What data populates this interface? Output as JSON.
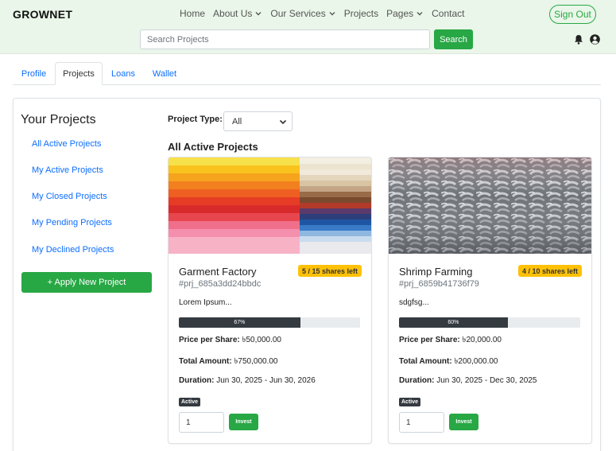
{
  "header": {
    "brand": "GROWNET",
    "nav": [
      {
        "label": "Home",
        "dropdown": false
      },
      {
        "label": "About Us",
        "dropdown": true
      },
      {
        "label": "Our Services",
        "dropdown": true
      },
      {
        "label": "Projects",
        "dropdown": false
      },
      {
        "label": "Pages",
        "dropdown": true
      },
      {
        "label": "Contact",
        "dropdown": false
      }
    ],
    "signout_label": "Sign Out",
    "search_placeholder": "Search Projects",
    "search_button": "Search",
    "icons": [
      "bell-icon",
      "user-icon"
    ]
  },
  "tabs": [
    {
      "label": "Profile",
      "active": false
    },
    {
      "label": "Projects",
      "active": true
    },
    {
      "label": "Loans",
      "active": false
    },
    {
      "label": "Wallet",
      "active": false
    }
  ],
  "sidebar": {
    "title": "Your Projects",
    "links": [
      "All Active Projects",
      "My Active Projects",
      "My Closed Projects",
      "My Pending Projects",
      "My Declined Projects"
    ],
    "apply_button": "+ Apply New Project"
  },
  "filter": {
    "label": "Project Type:",
    "selected": "All"
  },
  "section_title": "All Active Projects",
  "labels": {
    "price": "Price per Share:",
    "total": "Total Amount:",
    "duration": "Duration:",
    "invest": "Invest"
  },
  "projects": [
    {
      "name": "Garment Factory",
      "shares": "5 / 15 shares left",
      "id": "#prj_685a3dd24bbdc",
      "description": "Lorem Ipsum...",
      "progress_label": "67%",
      "progress": 0.67,
      "price": "৳50,000.00",
      "total": "৳750,000.00",
      "duration": "Jun 30, 2025 - Jun 30, 2026",
      "status": "Active",
      "qty": "1",
      "image": "colorful-fabric-stack"
    },
    {
      "name": "Shrimp Farming",
      "shares": "4 / 10 shares left",
      "id": "#prj_6859b41736f79",
      "description": "sdgfsg...",
      "progress_label": "60%",
      "progress": 0.6,
      "price": "৳20,000.00",
      "total": "৳200,000.00",
      "duration": "Jun 30, 2025 - Dec 30, 2025",
      "status": "Active",
      "qty": "1",
      "image": "shrimp-pile"
    }
  ],
  "colors": {
    "accent": "#28a745",
    "link": "#0d6efd",
    "header_bg": "#eaf6e9",
    "badge_warning": "#ffc107",
    "dark": "#343a40"
  }
}
